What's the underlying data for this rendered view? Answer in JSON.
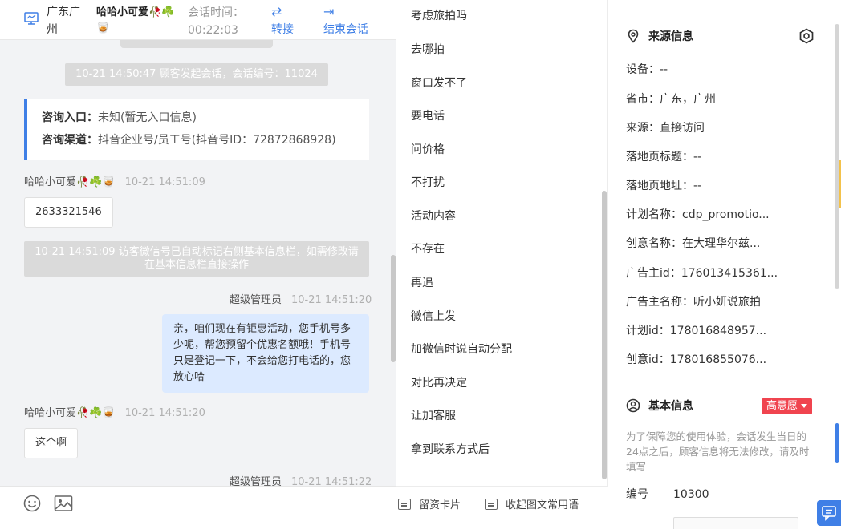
{
  "header": {
    "region": "广东广州",
    "visitor_name": "哈哈小可爱🥀☘️🥃",
    "session_time_label": "会话时间：",
    "session_time_value": "00:22:03",
    "transfer_label": "转接",
    "end_label": "结束会话",
    "accent_color": "#3f7fe6"
  },
  "chat": {
    "system_start": "10-21 14:50:47 顾客发起会话，会话编号：11024",
    "entry_label": "咨询入口：",
    "entry_value": "未知(暂无入口信息)",
    "channel_label": "咨询渠道：",
    "channel_value": "抖音企业号/员工号(抖音号ID：72872868928)",
    "msg1_sender": "哈哈小可爱🥀☘️🥃",
    "msg1_time": "10-21 14:51:09",
    "msg1_text": "2633321546",
    "system_wechat": "10-21 14:51:09 访客微信号已自动标记右侧基本信息栏，如需修改请在基本信息栏直接操作",
    "msg2_sender": "超级管理员",
    "msg2_time": "10-21 14:51:20",
    "msg2_text": "亲，咱们现在有钜惠活动，您手机号多少呢，帮您预留个优惠名额哦！手机号只是登记一下，不会给您打电话的，您放心哈",
    "msg3_sender": "哈哈小可爱🥀☘️🥃",
    "msg3_time": "10-21 14:51:20",
    "msg3_text": "这个啊",
    "msg4_sender": "超级管理员",
    "msg4_time": "10-21 14:51:22"
  },
  "toolbar": {
    "emoji_icon": "smile-icon",
    "image_icon": "image-icon"
  },
  "quick_replies": {
    "items": [
      "考虑旅拍吗",
      "去哪拍",
      "窗口发不了",
      "要电话",
      "问价格",
      "不打扰",
      "活动内容",
      "不存在",
      "再追",
      "微信上发",
      "加微信时说自动分配",
      "对比再决定",
      "让加客服",
      "拿到联系方式后"
    ],
    "card_label": "留资卡片",
    "collapse_label": "收起图文常用语"
  },
  "info": {
    "source_title": "来源信息",
    "device": "设备：--",
    "province": "省市：广东，广州",
    "source": "来源：直接访问",
    "landing_title": "落地页标题：--",
    "landing_url": "落地页地址：--",
    "plan_name": "计划名称：cdp_promotio...",
    "creative_name": "创意名称：在大理华尔兹...",
    "advertiser_id": "广告主id：176013415361...",
    "advertiser_name": "广告主名称：听小妍说旅拍",
    "plan_id": "计划id：178016848957...",
    "creative_id": "创意id：178016855076...",
    "basic_title": "基本信息",
    "intent_badge": "高意愿",
    "intent_color": "#f0444f",
    "notice": "为了保障您的使用体验，会话发生当日的24点之后，顾客信息将无法修改，请及时填写",
    "id_label": "编号",
    "id_value": "10300"
  }
}
